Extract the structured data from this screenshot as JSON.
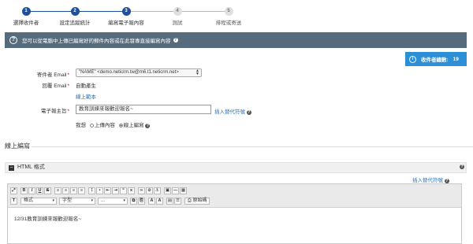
{
  "steps": [
    {
      "number": "1",
      "label": "選擇收件者",
      "state": "active"
    },
    {
      "number": "2",
      "label": "設定追蹤統計",
      "state": "active"
    },
    {
      "number": "3",
      "label": "編寫電子報內容",
      "state": "active"
    },
    {
      "number": "4",
      "label": "測試",
      "state": "pending"
    },
    {
      "number": "5",
      "label": "排程或寄送",
      "state": "pending"
    }
  ],
  "help_bar": {
    "text": "您可以從電腦中上傳已編寫好的郵件內容或在此發專直接編寫內容"
  },
  "recipients": {
    "label": "收件者總數:",
    "count": "19"
  },
  "form": {
    "sender_label": "寄件者 Email",
    "sender_value": "\"NAME\" <demo.neticrm.tw@m6.t1.neticrm.net>",
    "reply_label": "回覆 Email",
    "reply_value": "自動產生",
    "sample_link": "線上範本",
    "subject_label": "電子報主旨",
    "subject_value": "教育訓練來報歡迎報名~",
    "insert_token_link": "插入替代符號",
    "mode_prefix": "我想",
    "mode_upload": "上傳內容",
    "mode_online": "線上編寫"
  },
  "section": {
    "title": "線上編寫"
  },
  "panel": {
    "title": "HTML 格式",
    "insert_token_link": "插入替代符號",
    "format_combo": "格式",
    "font_combo": "字型",
    "size_combo": "...",
    "source_button": "原始碼",
    "content": "12/31教育訓練來報歡迎報名~"
  },
  "colors": {
    "primary": "#1e4f9b",
    "help_bar": "#566c7c",
    "info_box": "#2d8fd5",
    "required": "#cc0000",
    "link": "#2a6fb8"
  }
}
